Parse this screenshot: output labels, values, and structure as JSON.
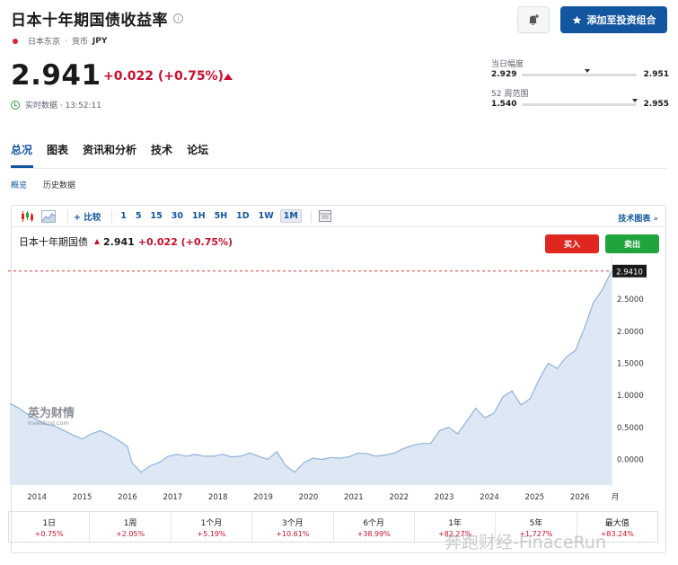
{
  "header": {
    "title": "日本十年期国债收益率",
    "info_icon": "i",
    "exchange": "日本东京",
    "currency_label": "货币",
    "currency": "JPY",
    "add_button_label": "添加至投资组合"
  },
  "quote": {
    "price": "2.941",
    "change": "+0.022 (+0.75%)",
    "realtime_label": "实时数据 · 13:52:11"
  },
  "ranges": {
    "day": {
      "label": "当日幅度",
      "low": "2.929",
      "high": "2.951",
      "position": 0.55
    },
    "week52": {
      "label": "52 周范围",
      "low": "1.540",
      "high": "2.955",
      "position": 0.99
    }
  },
  "tabs": [
    "总况",
    "图表",
    "资讯和分析",
    "技术",
    "论坛"
  ],
  "subtabs": [
    "概览",
    "历史数据"
  ],
  "toolbar": {
    "compare_label": "比较",
    "intervals": [
      "1",
      "5",
      "15",
      "30",
      "1H",
      "5H",
      "1D",
      "1W",
      "1M"
    ],
    "active_interval": "1M",
    "tech_chart_label": "技术图表"
  },
  "chart_header": {
    "name": "日本十年期国债",
    "price": "2.941",
    "change": "+0.022 (+0.75%)",
    "buy_label": "买入",
    "sell_label": "卖出"
  },
  "logo": {
    "cn": "英为财情",
    "en": "Investing.com"
  },
  "colors": {
    "accent": "#1256a0",
    "up": "#c8102e",
    "buy": "#e0271f",
    "sell": "#21a33e",
    "area_fill": "#dde8f4",
    "area_line": "#8fb3d9"
  },
  "chart_data": {
    "type": "area",
    "x": [
      2013.4,
      2013.6,
      2013.8,
      2014.0,
      2014.2,
      2014.4,
      2014.6,
      2014.8,
      2015.0,
      2015.2,
      2015.4,
      2015.6,
      2015.8,
      2016.0,
      2016.1,
      2016.3,
      2016.5,
      2016.7,
      2016.9,
      2017.1,
      2017.3,
      2017.5,
      2017.7,
      2017.9,
      2018.1,
      2018.3,
      2018.5,
      2018.7,
      2018.9,
      2019.1,
      2019.3,
      2019.5,
      2019.7,
      2019.9,
      2020.1,
      2020.3,
      2020.5,
      2020.7,
      2020.9,
      2021.1,
      2021.3,
      2021.5,
      2021.7,
      2021.9,
      2022.1,
      2022.3,
      2022.5,
      2022.7,
      2022.9,
      2023.1,
      2023.3,
      2023.5,
      2023.7,
      2023.9,
      2024.1,
      2024.3,
      2024.5,
      2024.7,
      2024.9,
      2025.1,
      2025.3,
      2025.5,
      2025.7,
      2025.9,
      2026.1,
      2026.3,
      2026.5,
      2026.6,
      2026.7
    ],
    "y": [
      0.87,
      0.8,
      0.7,
      0.62,
      0.55,
      0.52,
      0.45,
      0.38,
      0.32,
      0.4,
      0.45,
      0.38,
      0.3,
      0.2,
      -0.05,
      -0.2,
      -0.1,
      -0.05,
      0.05,
      0.08,
      0.05,
      0.08,
      0.05,
      0.05,
      0.08,
      0.04,
      0.05,
      0.1,
      0.05,
      0.0,
      0.12,
      -0.1,
      -0.2,
      -0.05,
      0.02,
      0.0,
      0.03,
      0.02,
      0.04,
      0.1,
      0.09,
      0.05,
      0.07,
      0.1,
      0.17,
      0.22,
      0.25,
      0.25,
      0.45,
      0.5,
      0.4,
      0.6,
      0.8,
      0.65,
      0.72,
      0.98,
      1.07,
      0.85,
      0.95,
      1.25,
      1.5,
      1.42,
      1.6,
      1.7,
      2.05,
      2.45,
      2.65,
      2.8,
      2.941
    ],
    "xlim": [
      2013.4,
      2026.7
    ],
    "ylim": [
      -0.4,
      3.05
    ],
    "x_ticks": [
      "2014",
      "2015",
      "2016",
      "2017",
      "2018",
      "2019",
      "2020",
      "2021",
      "2022",
      "2023",
      "2024",
      "2025",
      "2026",
      "月"
    ],
    "y_ticks": [
      "2.5000",
      "2.0000",
      "1.5000",
      "1.0000",
      "0.5000",
      "0.0000"
    ],
    "y_tick_values": [
      2.5,
      2.0,
      1.5,
      1.0,
      0.5,
      0.0
    ],
    "last_label": "2.9410",
    "last_value": 2.941
  },
  "performance": [
    {
      "label": "1日",
      "value": "+0.75%"
    },
    {
      "label": "1周",
      "value": "+2.05%"
    },
    {
      "label": "1个月",
      "value": "+5.19%"
    },
    {
      "label": "3个月",
      "value": "+10.61%"
    },
    {
      "label": "6个月",
      "value": "+38.99%"
    },
    {
      "label": "1年",
      "value": "+82.27%"
    },
    {
      "label": "5年",
      "value": "+1,727%"
    },
    {
      "label": "最大值",
      "value": "+83.24%"
    }
  ],
  "watermark": "奔跑财经-FinaceRun"
}
